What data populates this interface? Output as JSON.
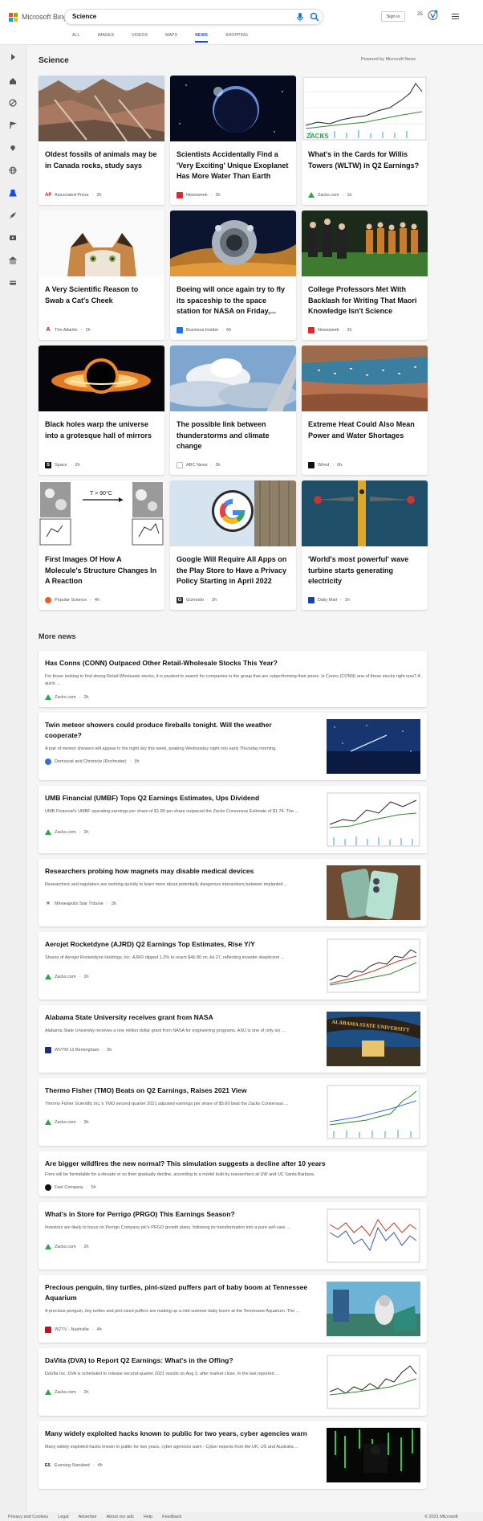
{
  "header": {
    "logo_text": "Microsoft Bing",
    "search_value": "Science",
    "sign_in": "Sign in",
    "points": "25"
  },
  "tabs": [
    "ALL",
    "IMAGES",
    "VIDEOS",
    "MAPS",
    "NEWS",
    "SHOPPING"
  ],
  "active_tab": "NEWS",
  "section": {
    "title": "Science",
    "powered_by": "Powered by Microsoft News"
  },
  "cards": [
    {
      "title": "Oldest fossils of animals may be in Canada rocks, study says",
      "source": "Associated Press",
      "age": "2h"
    },
    {
      "title": "Scientists Accidentally Find a 'Very Exciting' Unique Exoplanet Has More Water Than Earth",
      "source": "Newsweek",
      "age": "2h"
    },
    {
      "title": "What's in the Cards for Willis Towers (WLTW) in Q2 Earnings?",
      "source": "Zacks.com",
      "age": "1h"
    },
    {
      "title": "A Very Scientific Reason to Swab a Cat's Cheek",
      "source": "The Atlantic",
      "age": "2h"
    },
    {
      "title": "Boeing will once again try to fly its spaceship to the space station for NASA on Friday,...",
      "source": "Business Insider",
      "age": "6h"
    },
    {
      "title": "College Professors Met With Backlash for Writing That Maori Knowledge Isn't Science",
      "source": "Newsweek",
      "age": "2h"
    },
    {
      "title": "Black holes warp the universe into a grotesque hall of mirrors",
      "source": "Space",
      "age": "2h"
    },
    {
      "title": "The possible link between thunderstorms and climate change",
      "source": "ABC News",
      "age": "3h"
    },
    {
      "title": "Extreme Heat Could Also Mean Power and Water Shortages",
      "source": "Wired",
      "age": "6h"
    },
    {
      "title": "First Images Of How A Molecule's Structure Changes In A Reaction",
      "source": "Popular Science",
      "age": "4h"
    },
    {
      "title": "Google Will Require All Apps on the Play Store to Have a Privacy Policy Starting in April 2022",
      "source": "Gizmodo",
      "age": "2h"
    },
    {
      "title": "'World's most powerful' wave turbine starts generating electricity",
      "source": "Daily Mail",
      "age": "1h"
    }
  ],
  "card_image_text": {
    "molecule_temp": "T > 90°C",
    "zacks": "ZACKS"
  },
  "more_news": {
    "title": "More news",
    "items": [
      {
        "title": "Has Conns (CONN) Outpaced Other Retail-Wholesale Stocks This Year?",
        "snippet": "For those looking to find strong Retail-Wholesale stocks, it is prudent to search for companies in the group that are outperforming their peers. Is Conns (CONN) one of those stocks right now? A quick ...",
        "source": "Zacks.com",
        "age": "2h"
      },
      {
        "title": "Twin meteor showers could produce fireballs tonight. Will the weather cooperate?",
        "snippet": "A pair of meteor showers will appear in the night sky this week, peaking Wednesday night into early Thursday morning.",
        "source": "Democrat and Chronicle (Rochester)",
        "age": "3h"
      },
      {
        "title": "UMB Financial (UMBF) Tops Q2 Earnings Estimates, Ups Dividend",
        "snippet": "UMB Financial's UMBF operating earnings per share of $1.80 per share outpaced the Zacks Consensus Estimate of $1.74. The ...",
        "source": "Zacks.com",
        "age": "2h"
      },
      {
        "title": "Researchers probing how magnets may disable medical devices",
        "snippet": "Researchers and regulators are working quickly to learn more about potentially dangerous interactions between implanted ...",
        "source": "Minneapolis Star Tribune",
        "age": "3h"
      },
      {
        "title": "Aerojet Rocketdyne (AJRD) Q2 Earnings Top Estimates, Rise Y/Y",
        "snippet": "Shares of Aerojet Rocketdyne Holdings, Inc. AJRD dipped 1.2% to reach $46.80 on Jul 27, reflecting investor skepticism ...",
        "source": "Zacks.com",
        "age": "2h"
      },
      {
        "title": "Alabama State University receives grant from NASA",
        "snippet": "Alabama State University receives a one million dollar grant from NASA for engineering programs. ASU is one of only six ...",
        "source": "WVTM 13 Birmingham",
        "age": "3h"
      },
      {
        "title": "Thermo Fisher (TMO) Beats on Q2 Earnings, Raises 2021 View",
        "snippet": "Thermo Fisher Scientific Inc.'s TMO second-quarter 2021 adjusted earnings per share of $5.60 beat the Zacks Consensus ...",
        "source": "Zacks.com",
        "age": "3h"
      },
      {
        "title": "Are bigger wildfires the new normal? This simulation suggests a decline after 10 years",
        "snippet": "Fires will be formidable for a decade or so then gradually decline, according to a model built by researchers at UW and UC Santa Barbara.",
        "source": "Fast Company",
        "age": "5h"
      },
      {
        "title": "What's in Store for Perrigo (PRGO) This Earnings Season?",
        "snippet": "Investors are likely to focus on Perrigo Company plc's PRGO growth plans, following its transformation into a pure self-care ...",
        "source": "Zacks.com",
        "age": "2h"
      },
      {
        "title": "Precious penguin, tiny turtles, pint-sized puffers part of baby boom at Tennessee Aquarium",
        "snippet": "A precious penguin, tiny turtles and pint-sized puffers are making up a mid-summer baby boom at the Tennessee Aquarium. The ...",
        "source": "WZTV - Nashville",
        "age": "4h"
      },
      {
        "title": "DaVita (DVA) to Report Q2 Earnings: What's in the Offing?",
        "snippet": "DaVita Inc. DVA is scheduled to release second-quarter 2021 results on Aug 3, after market close. In the last reported ...",
        "source": "Zacks.com",
        "age": "2h"
      },
      {
        "title": "Many widely exploited hacks known to public for two years, cyber agencies warn",
        "snippet": "Many widely exploited hacks known to public for two years, cyber agencies warn - Cyber experts from the UK, US and Australia ...",
        "source": "Evening Standard",
        "age": "4h"
      }
    ]
  },
  "thumb_text": {
    "alabama_sign": "ALABAMA STATE UNIVERSITY"
  },
  "footer": {
    "links": [
      "Privacy and Cookies",
      "Legal",
      "Advertise",
      "About our ads",
      "Help",
      "Feedback"
    ],
    "copyright": "© 2021 Microsoft"
  },
  "colors": {
    "accent": "#174ae4",
    "zacks_green": "#27a844",
    "newsweek_red": "#e0262e"
  }
}
